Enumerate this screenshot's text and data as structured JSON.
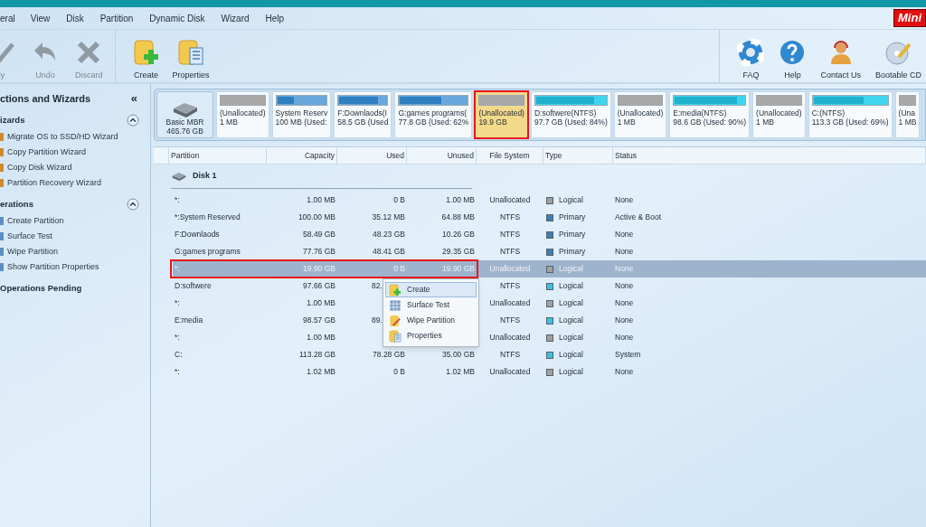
{
  "menu": [
    "eral",
    "View",
    "Disk",
    "Partition",
    "Dynamic Disk",
    "Wizard",
    "Help"
  ],
  "logo": "Mini",
  "toolbar_left": [
    {
      "label": "ly",
      "disabled": true
    },
    {
      "label": "Undo",
      "disabled": true
    },
    {
      "label": "Discard",
      "disabled": true
    }
  ],
  "toolbar_mid": [
    {
      "label": "Create",
      "disabled": false
    },
    {
      "label": "Properties",
      "disabled": false
    }
  ],
  "toolbar_right": [
    {
      "label": "FAQ",
      "disabled": false
    },
    {
      "label": "Help",
      "disabled": false
    },
    {
      "label": "Contact Us",
      "disabled": false
    },
    {
      "label": "Bootable CD",
      "disabled": false
    }
  ],
  "sidebar": {
    "title": "ctions and Wizards",
    "collapse": "«",
    "sections": [
      {
        "title": "izards",
        "items": [
          "Migrate OS to SSD/HD Wizard",
          "Copy Partition Wizard",
          "Copy Disk Wizard",
          "Partition Recovery Wizard"
        ]
      },
      {
        "title": "erations",
        "items": [
          "Create Partition",
          "Surface Test",
          "Wipe Partition",
          "Show Partition Properties"
        ]
      },
      {
        "title": "Operations Pending"
      }
    ]
  },
  "disk_map": {
    "disk": {
      "label": "Basic MBR",
      "size": "465.76 GB"
    },
    "partitions": [
      {
        "name": "(Unallocated)",
        "detail": "1 MB",
        "kind": "unallocated",
        "selected": false
      },
      {
        "name": "System Reserv",
        "detail": "100 MB (Used:",
        "kind": "primary",
        "level": 0.35,
        "selected": false
      },
      {
        "name": "F:Downlaods(I",
        "detail": "58.5 GB (Used",
        "kind": "primary",
        "level": 0.82,
        "selected": false
      },
      {
        "name": "G:games programs(",
        "detail": "77.8 GB (Used: 62%",
        "kind": "primary",
        "level": 0.62,
        "selected": false
      },
      {
        "name": "(Unallocated)",
        "detail": "19.9 GB",
        "kind": "unallocated",
        "selected": true
      },
      {
        "name": "D:softwere(NTFS)",
        "detail": "97.7 GB (Used: 84%)",
        "kind": "logical",
        "level": 0.84,
        "selected": false
      },
      {
        "name": "(Unallocated)",
        "detail": "1 MB",
        "kind": "unallocated",
        "selected": false
      },
      {
        "name": "E:media(NTFS)",
        "detail": "98.6 GB (Used: 90%)",
        "kind": "logical",
        "level": 0.9,
        "selected": false
      },
      {
        "name": "(Unallocated)",
        "detail": "1 MB",
        "kind": "unallocated",
        "selected": false
      },
      {
        "name": "C:(NTFS)",
        "detail": "113.3 GB (Used: 69%)",
        "kind": "logical",
        "level": 0.69,
        "selected": false
      },
      {
        "name": "(Una",
        "detail": "1 MB",
        "kind": "unallocated",
        "selected": false
      }
    ]
  },
  "table": {
    "columns": [
      "Partition",
      "Capacity",
      "Used",
      "Unused",
      "File System",
      "Type",
      "Status"
    ],
    "group": "Disk 1",
    "rows": [
      {
        "partition": "*:",
        "capacity": "1.00 MB",
        "used": "0 B",
        "unused": "1.00 MB",
        "file_system": "Unallocated",
        "type": "Logical",
        "color": "#a0a0a0",
        "status": "None",
        "selected": false
      },
      {
        "partition": "*:System Reserved",
        "capacity": "100.00 MB",
        "used": "35.12 MB",
        "unused": "64.88 MB",
        "file_system": "NTFS",
        "type": "Primary",
        "color": "#3f7fb3",
        "status": "Active & Boot",
        "selected": false
      },
      {
        "partition": "F:Downlaods",
        "capacity": "58.49 GB",
        "used": "48.23 GB",
        "unused": "10.26 GB",
        "file_system": "NTFS",
        "type": "Primary",
        "color": "#3f7fb3",
        "status": "None",
        "selected": false
      },
      {
        "partition": "G:games programs",
        "capacity": "77.76 GB",
        "used": "48.41 GB",
        "unused": "29.35 GB",
        "file_system": "NTFS",
        "type": "Primary",
        "color": "#3f7fb3",
        "status": "None",
        "selected": false
      },
      {
        "partition": "*:",
        "capacity": "19.90 GB",
        "used": "0 B",
        "unused": "19.90 GB",
        "file_system": "Unallocated",
        "type": "Logical",
        "color": "#a0a0a0",
        "status": "None",
        "selected": true
      },
      {
        "partition": "D:softwere",
        "capacity": "97.66 GB",
        "used": "82.",
        "used_cut": true,
        "file_system": "NTFS",
        "type": "Logical",
        "color": "#3cc0e0",
        "status": "None",
        "selected": false
      },
      {
        "partition": "*:",
        "capacity": "1.00 MB",
        "file_system": "Unallocated",
        "type": "Logical",
        "color": "#a0a0a0",
        "status": "None",
        "selected": false
      },
      {
        "partition": "E:media",
        "capacity": "98.57 GB",
        "used": "89.",
        "used_cut": true,
        "file_system": "NTFS",
        "type": "Logical",
        "color": "#3cc0e0",
        "status": "None",
        "selected": false
      },
      {
        "partition": "*:",
        "capacity": "1.00 MB",
        "file_system": "Unallocated",
        "type": "Logical",
        "color": "#a0a0a0",
        "status": "None",
        "selected": false
      },
      {
        "partition": "C:",
        "capacity": "113.28 GB",
        "used": "78.28 GB",
        "unused": "35.00 GB",
        "file_system": "NTFS",
        "type": "Logical",
        "color": "#3cc0e0",
        "status": "System",
        "selected": false
      },
      {
        "partition": "*:",
        "capacity": "1.02 MB",
        "used": "0 B",
        "unused": "1.02 MB",
        "file_system": "Unallocated",
        "type": "Logical",
        "color": "#a0a0a0",
        "status": "None",
        "selected": false
      }
    ]
  },
  "context_menu": [
    {
      "label": "Create",
      "selected": true
    },
    {
      "label": "Surface Test",
      "selected": false
    },
    {
      "label": "Wipe Partition",
      "selected": false
    },
    {
      "label": "Properties",
      "selected": false
    }
  ]
}
